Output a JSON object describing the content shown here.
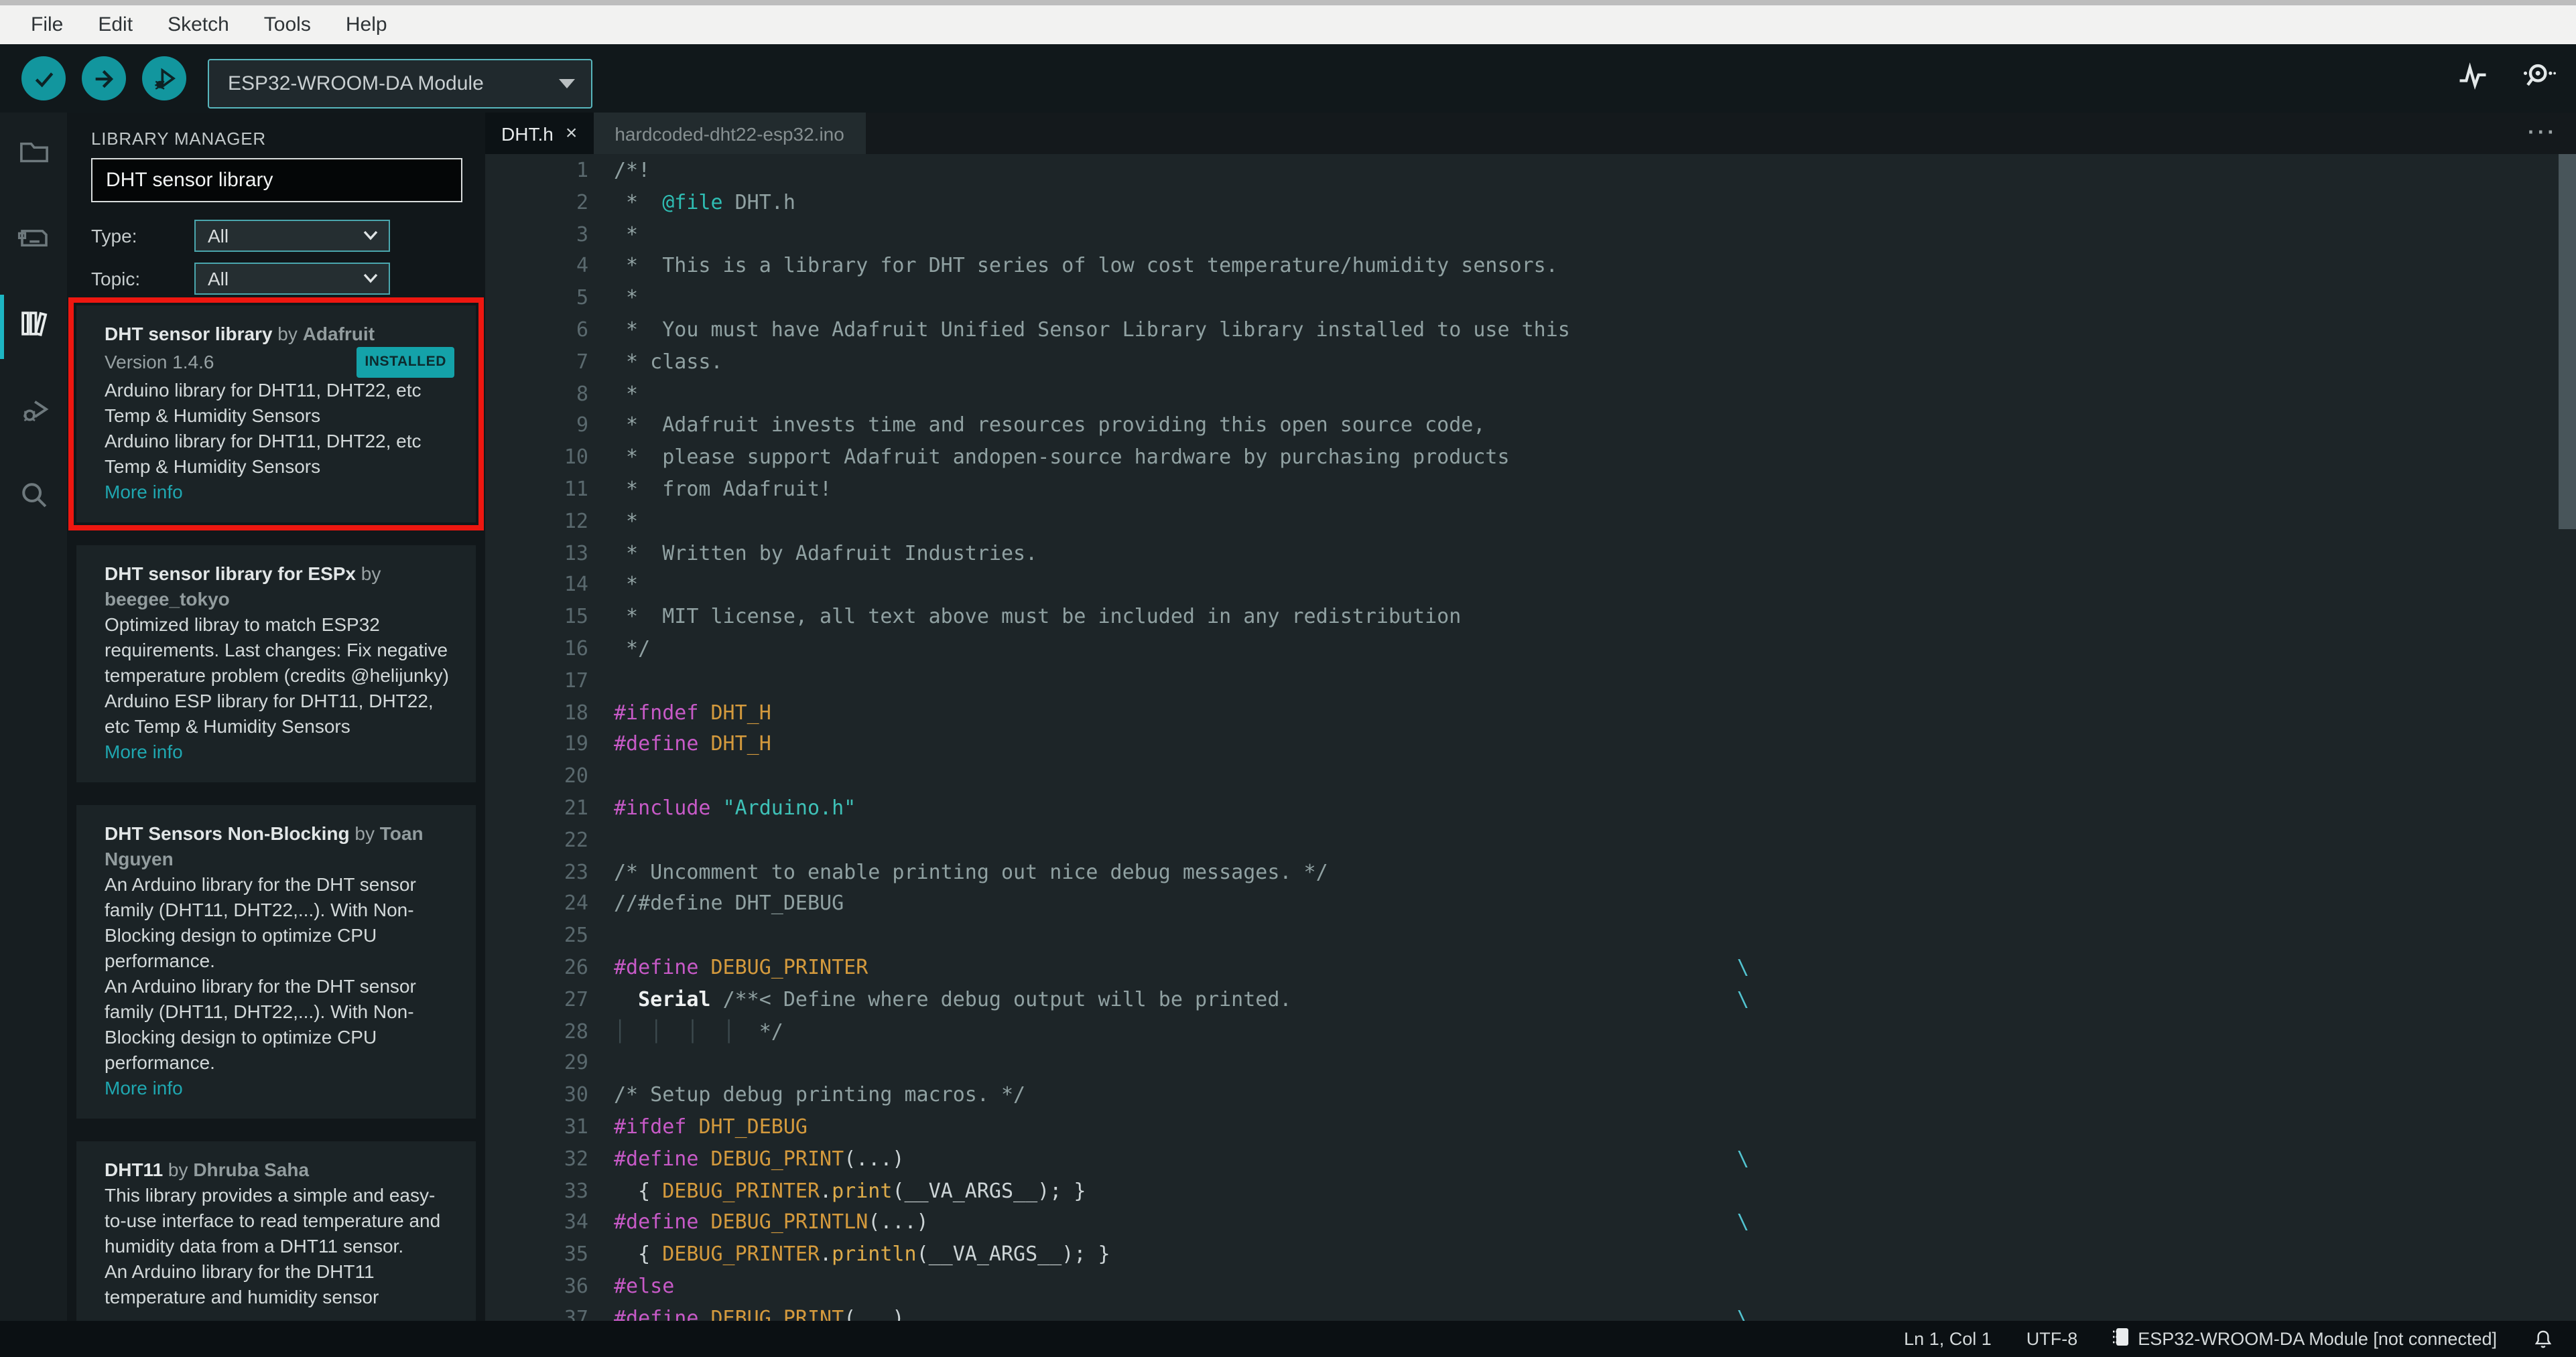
{
  "menu_bar": {
    "items": [
      "File",
      "Edit",
      "Sketch",
      "Tools",
      "Help"
    ]
  },
  "toolbar": {
    "verify_button": "verify",
    "upload_button": "upload",
    "debug_button": "start-debugging",
    "board_selector_value": "ESP32-WROOM-DA Module",
    "right_icons": [
      "serial-plotter",
      "serial-monitor"
    ],
    "teal": "#12969e"
  },
  "activity_bar": {
    "items": [
      {
        "name": "sketchbook",
        "active": false
      },
      {
        "name": "boards-manager",
        "active": false
      },
      {
        "name": "library-manager",
        "active": true
      },
      {
        "name": "debug",
        "active": false
      },
      {
        "name": "search",
        "active": false
      }
    ]
  },
  "library_manager": {
    "title": "LIBRARY MANAGER",
    "search_value": "DHT sensor library",
    "filters": [
      {
        "label": "Type:",
        "value": "All"
      },
      {
        "label": "Topic:",
        "value": "All"
      }
    ],
    "results": [
      {
        "name": "DHT sensor library",
        "by_word": "by",
        "author": "Adafruit",
        "version": "Version 1.4.6",
        "badge": "INSTALLED",
        "description": [
          "Arduino library for DHT11, DHT22, etc Temp & Humidity Sensors",
          "Arduino library for DHT11, DHT22, etc Temp & Humidity Sensors"
        ],
        "more_info": "More info",
        "highlighted": true
      },
      {
        "name": "DHT sensor library for ESPx",
        "by_word": "by",
        "author": "beegee_tokyo",
        "description": [
          "Optimized libray to match ESP32 requirements. Last changes: Fix negative temperature problem (credits @helijunky)",
          "Arduino ESP library for DHT11, DHT22, etc Temp & Humidity Sensors"
        ],
        "more_info": "More info",
        "highlighted": false
      },
      {
        "name": "DHT Sensors Non-Blocking",
        "by_word": "by",
        "author": "Toan Nguyen",
        "description": [
          "An Arduino library for the DHT sensor family (DHT11, DHT22,...). With Non-Blocking design to optimize CPU performance.",
          "An Arduino library for the DHT sensor family (DHT11, DHT22,...). With Non-Blocking design to optimize CPU performance."
        ],
        "more_info": "More info",
        "highlighted": false
      },
      {
        "name": "DHT11",
        "by_word": "by",
        "author": "Dhruba Saha",
        "description": [
          "This library provides a simple and easy-to-use interface to read temperature and humidity data from a DHT11 sensor.",
          "An Arduino library for the DHT11 temperature and humidity sensor"
        ],
        "more_info": null,
        "highlighted": false
      }
    ],
    "annotation_color": "#ee1710"
  },
  "editor": {
    "tabs": [
      {
        "label": "DHT.h",
        "active": true,
        "close_glyph": "×"
      },
      {
        "label": "hardcoded-dht22-esp32.ino",
        "active": false
      }
    ],
    "overflow_menu": "···",
    "lines": [
      [
        [
          "c",
          "/*!"
        ]
      ],
      [
        [
          "c",
          " *  "
        ],
        [
          "tag",
          "@file"
        ],
        [
          "c",
          " DHT.h"
        ]
      ],
      [
        [
          "c",
          " *"
        ]
      ],
      [
        [
          "c",
          " *  This is a library for DHT series of low cost temperature/humidity sensors."
        ]
      ],
      [
        [
          "c",
          " *"
        ]
      ],
      [
        [
          "c",
          " *  You must have Adafruit Unified Sensor Library library installed to use this"
        ]
      ],
      [
        [
          "c",
          " * class."
        ]
      ],
      [
        [
          "c",
          " *"
        ]
      ],
      [
        [
          "c",
          " *  Adafruit invests time and resources providing this open source code,"
        ]
      ],
      [
        [
          "c",
          " *  please support Adafruit andopen-source hardware by purchasing products"
        ]
      ],
      [
        [
          "c",
          " *  from Adafruit!"
        ]
      ],
      [
        [
          "c",
          " *"
        ]
      ],
      [
        [
          "c",
          " *  Written by Adafruit Industries."
        ]
      ],
      [
        [
          "c",
          " *"
        ]
      ],
      [
        [
          "c",
          " *  MIT license, all text above must be included in any redistribution"
        ]
      ],
      [
        [
          "c",
          " */"
        ]
      ],
      [],
      [
        [
          "pre",
          "#ifndef"
        ],
        [
          "pl",
          " "
        ],
        [
          "mac",
          "DHT_H"
        ]
      ],
      [
        [
          "pre",
          "#define"
        ],
        [
          "pl",
          " "
        ],
        [
          "mac",
          "DHT_H"
        ]
      ],
      [],
      [
        [
          "pre",
          "#include"
        ],
        [
          "pl",
          " "
        ],
        [
          "str",
          "\"Arduino.h\""
        ]
      ],
      [],
      [
        [
          "c",
          "/* Uncomment to enable printing out nice debug messages. */"
        ]
      ],
      [
        [
          "c",
          "//#define DHT_DEBUG"
        ]
      ],
      [],
      [
        [
          "pre",
          "#define"
        ],
        [
          "pl",
          " "
        ],
        [
          "mac",
          "DEBUG_PRINTER"
        ],
        [
          "bs",
          "\\"
        ]
      ],
      [
        [
          "pl",
          "  "
        ],
        [
          "kw",
          "Serial"
        ],
        [
          "pl",
          " "
        ],
        [
          "c",
          "/**< Define where debug output will be printed."
        ],
        [
          "bs",
          "\\"
        ]
      ],
      [
        [
          "guide",
          "│  │  │  │  "
        ],
        [
          "c",
          "*/"
        ]
      ],
      [],
      [
        [
          "c",
          "/* Setup debug printing macros. */"
        ]
      ],
      [
        [
          "pre",
          "#ifdef"
        ],
        [
          "pl",
          " "
        ],
        [
          "mac",
          "DHT_DEBUG"
        ]
      ],
      [
        [
          "pre",
          "#define"
        ],
        [
          "pl",
          " "
        ],
        [
          "mac",
          "DEBUG_PRINT"
        ],
        [
          "pl",
          "(...)"
        ],
        [
          "bs",
          "\\"
        ]
      ],
      [
        [
          "pl",
          "  { "
        ],
        [
          "mac",
          "DEBUG_PRINTER"
        ],
        [
          "pl",
          "."
        ],
        [
          "fn",
          "print"
        ],
        [
          "pl",
          "(__VA_ARGS__); }"
        ]
      ],
      [
        [
          "pre",
          "#define"
        ],
        [
          "pl",
          " "
        ],
        [
          "mac",
          "DEBUG_PRINTLN"
        ],
        [
          "pl",
          "(...)"
        ],
        [
          "bs",
          "\\"
        ]
      ],
      [
        [
          "pl",
          "  { "
        ],
        [
          "mac",
          "DEBUG_PRINTER"
        ],
        [
          "pl",
          "."
        ],
        [
          "fn",
          "println"
        ],
        [
          "pl",
          "(__VA_ARGS__); }"
        ]
      ],
      [
        [
          "pre",
          "#else"
        ]
      ],
      [
        [
          "pre",
          "#define"
        ],
        [
          "pl",
          " "
        ],
        [
          "mac",
          "DEBUG_PRINT"
        ],
        [
          "pl",
          "(...)"
        ],
        [
          "bs",
          "\\"
        ]
      ]
    ]
  },
  "status_bar": {
    "position": "Ln 1, Col 1",
    "encoding": "UTF-8",
    "board_status": "ESP32-WROOM-DA Module [not connected]"
  }
}
